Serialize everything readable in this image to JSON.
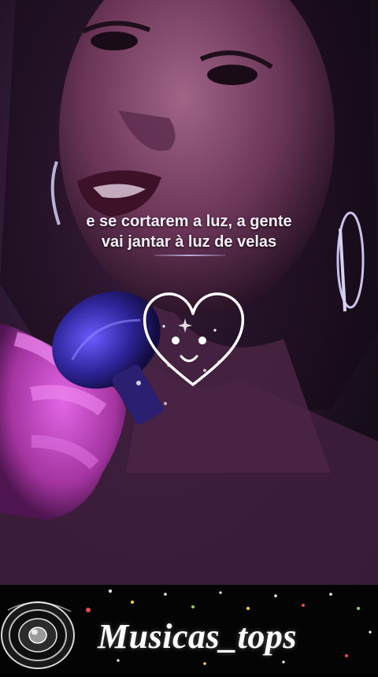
{
  "video": {
    "lyrics": {
      "line1": "e se cortarem a luz, a gente",
      "line2": "vai jantar à luz de velas"
    },
    "overlay_icon": "heart-smiley-icon",
    "palette": {
      "glow": "#c24bd8",
      "skin": "#7a3d63",
      "microphone": "#3b2fb0"
    }
  },
  "footer": {
    "channel_name": "Musicas_tops",
    "logo_icon": "speaker-icon"
  }
}
